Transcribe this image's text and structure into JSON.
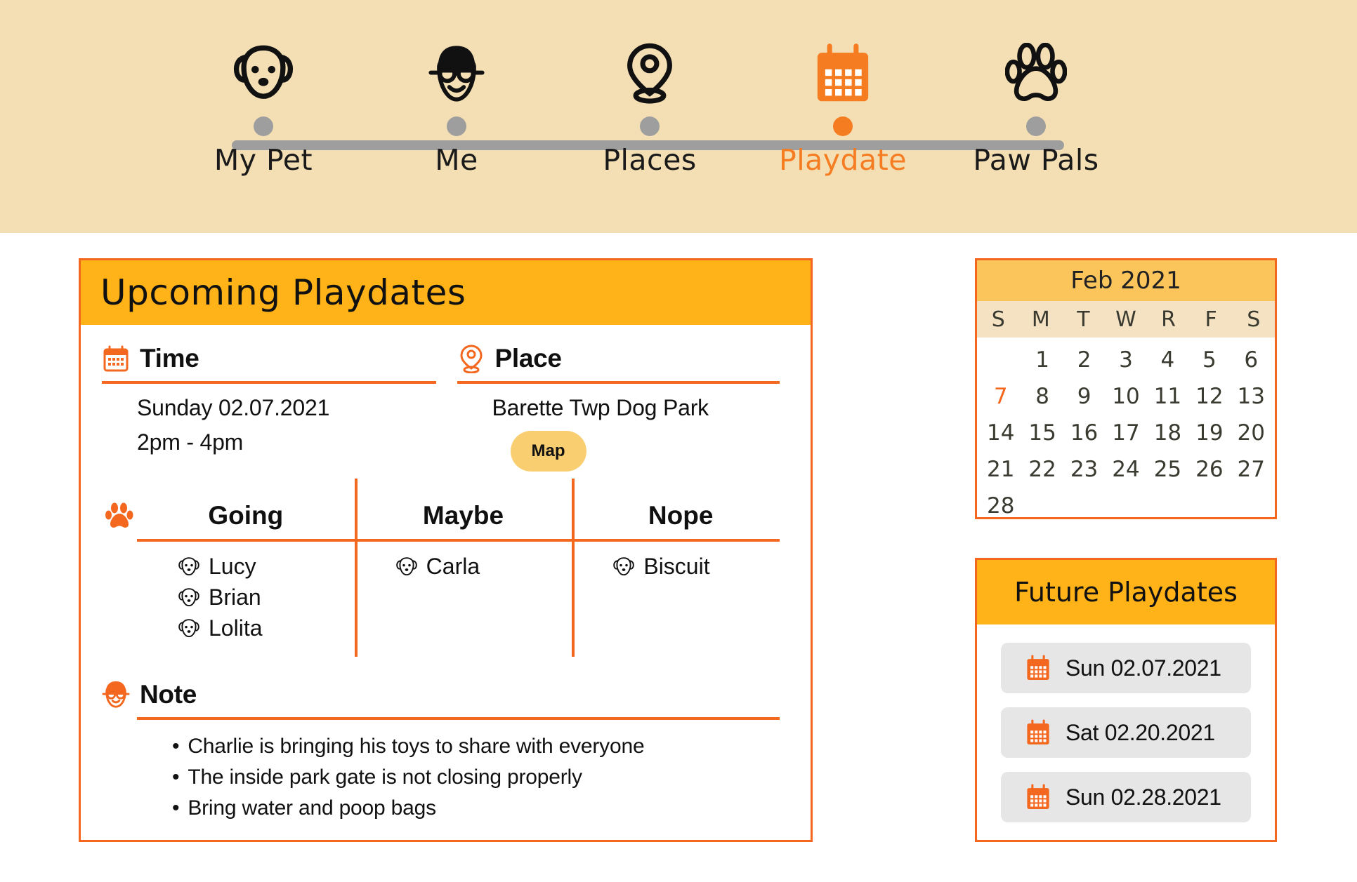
{
  "nav": {
    "steps": [
      {
        "label": "My Pet",
        "icon": "dog-face-icon",
        "active": false
      },
      {
        "label": "Me",
        "icon": "person-glasses-icon",
        "active": false
      },
      {
        "label": "Places",
        "icon": "location-pin-icon",
        "active": false
      },
      {
        "label": "Playdate",
        "icon": "calendar-icon",
        "active": true
      },
      {
        "label": "Paw Pals",
        "icon": "paw-print-icon",
        "active": false
      }
    ]
  },
  "colors": {
    "band": "#f4dfb4",
    "accent_orange": "#f4671f",
    "header_amber": "#ffb318",
    "calendar_header": "#fbc55c",
    "map_button": "#f9ce70",
    "muted_gray": "#9e9e9e"
  },
  "main": {
    "title": "Upcoming Playdates",
    "time": {
      "heading": "Time",
      "icon": "calendar-icon",
      "date": "Sunday 02.07.2021",
      "hours": "2pm - 4pm"
    },
    "place": {
      "heading": "Place",
      "icon": "location-pin-icon",
      "name": "Barette Twp Dog Park",
      "map_button": "Map"
    },
    "rsvp": {
      "icon": "paw-print-icon",
      "columns": [
        {
          "name": "Going",
          "members": [
            "Lucy",
            "Brian",
            "Lolita"
          ]
        },
        {
          "name": "Maybe",
          "members": [
            "Carla"
          ]
        },
        {
          "name": "Nope",
          "members": [
            "Biscuit"
          ]
        }
      ]
    },
    "note": {
      "heading": "Note",
      "icon": "person-glasses-icon",
      "bullet": "•",
      "items": [
        "Charlie is bringing his toys to share with everyone",
        "The inside park gate is not closing properly",
        "Bring water and poop bags"
      ]
    }
  },
  "calendar": {
    "title": "Feb 2021",
    "dow": [
      "S",
      "M",
      "T",
      "W",
      "R",
      "F",
      "S"
    ],
    "lead_blanks": 1,
    "days": [
      1,
      2,
      3,
      4,
      5,
      6,
      7,
      8,
      9,
      10,
      11,
      12,
      13,
      14,
      15,
      16,
      17,
      18,
      19,
      20,
      21,
      22,
      23,
      24,
      25,
      26,
      27,
      28
    ],
    "highlighted_day": 7
  },
  "future": {
    "title": "Future Playdates",
    "items": [
      {
        "icon": "calendar-icon",
        "label": "Sun 02.07.2021"
      },
      {
        "icon": "calendar-icon",
        "label": "Sat 02.20.2021"
      },
      {
        "icon": "calendar-icon",
        "label": "Sun 02.28.2021"
      }
    ]
  }
}
